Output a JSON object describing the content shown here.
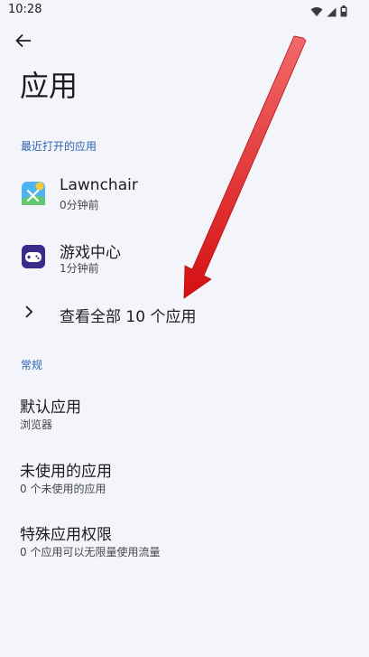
{
  "status_bar": {
    "time": "10:28",
    "icons": [
      "wifi-icon",
      "signal-icon",
      "battery-icon"
    ]
  },
  "header": {
    "back_icon": "arrow-left-icon",
    "title": "应用"
  },
  "recent_section": {
    "header": "最近打开的应用",
    "apps": [
      {
        "name": "Lawnchair",
        "subtitle": "0分钟前",
        "icon": "lawnchair-icon"
      },
      {
        "name": "游戏中心",
        "subtitle": "1分钟前",
        "icon": "game-center-icon"
      }
    ],
    "see_all_label": "查看全部 10 个应用",
    "see_all_icon": "chevron-right-icon"
  },
  "general_section": {
    "header": "常规",
    "items": [
      {
        "title": "默认应用",
        "subtitle": "浏览器"
      },
      {
        "title": "未使用的应用",
        "subtitle": "0 个未使用的应用"
      },
      {
        "title": "特殊应用权限",
        "subtitle": "0 个应用可以无限量使用流量"
      }
    ]
  },
  "colors": {
    "background": "#f3f5fa",
    "accent": "#2d63b0",
    "annotation_arrow": "#e8191c"
  }
}
